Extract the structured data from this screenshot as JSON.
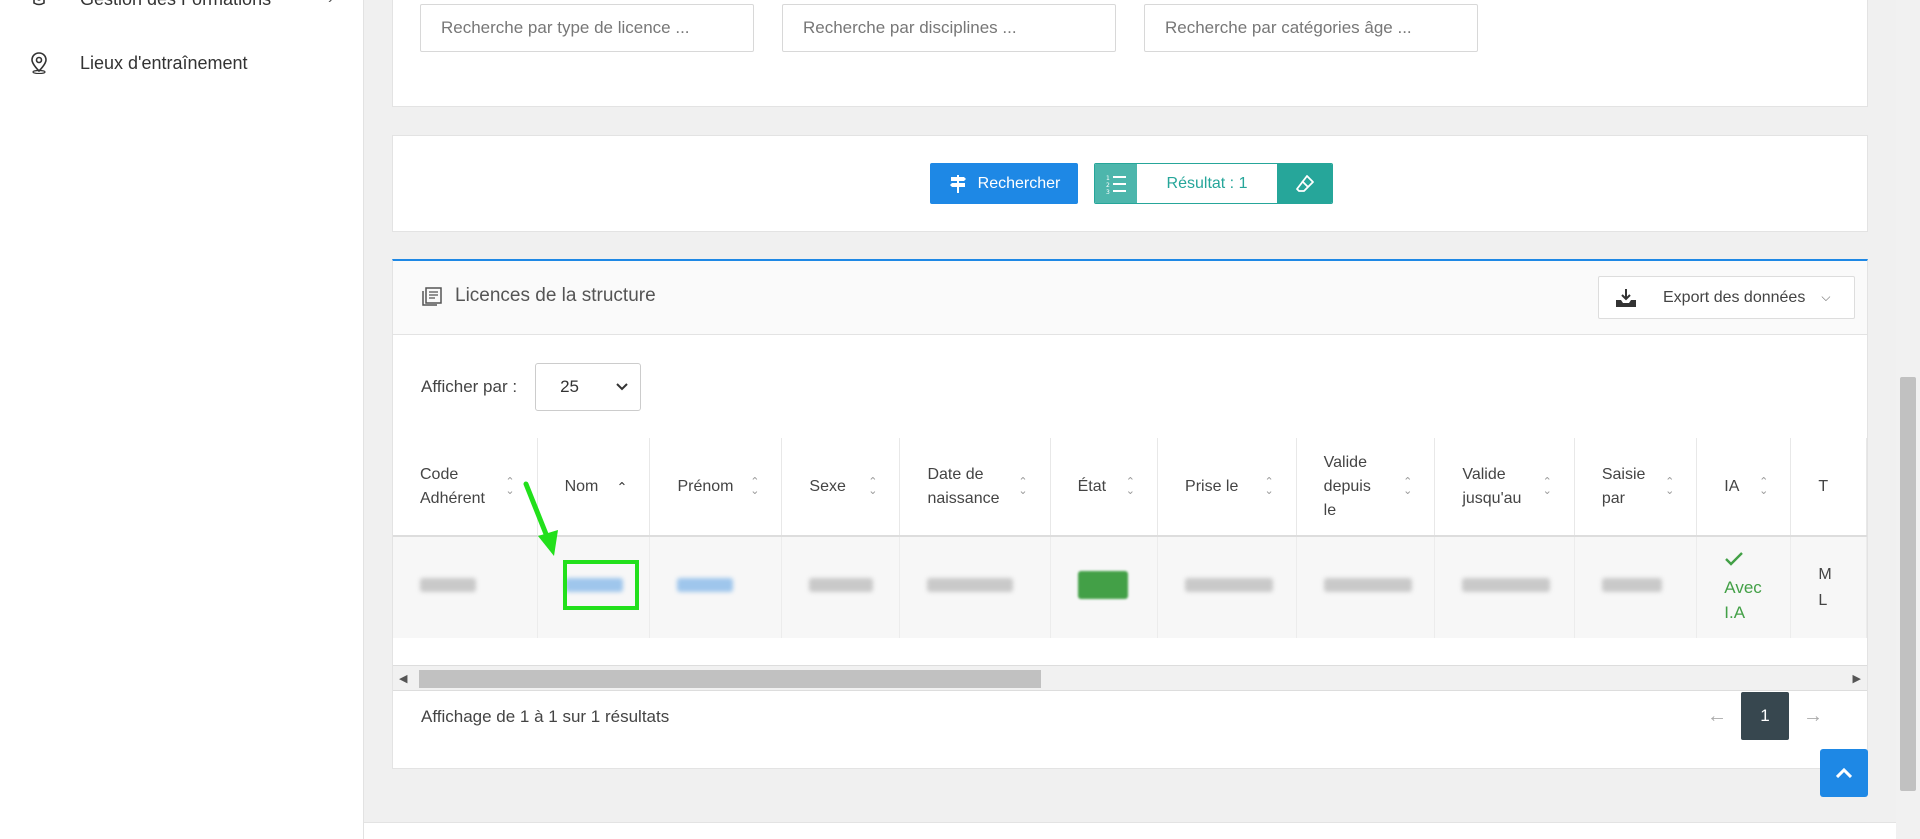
{
  "sidebar": {
    "items": [
      {
        "label": "Gestion des Formations",
        "icon": "graduation-cap-icon"
      },
      {
        "label": "Lieux d'entraînement",
        "icon": "map-pin-icon"
      }
    ]
  },
  "search": {
    "licence_placeholder": "Recherche par type de licence ...",
    "discipline_placeholder": "Recherche par disciplines ...",
    "category_placeholder": "Recherche par catégories âge ..."
  },
  "actions": {
    "search_label": "Rechercher",
    "result_label": "Résultat : 1"
  },
  "table_panel": {
    "title": "Licences de la structure",
    "export_label": "Export des données",
    "per_page_label": "Afficher par :",
    "per_page_value": "25",
    "footer": "Affichage de 1 à 1 sur 1 résultats",
    "current_page": "1"
  },
  "table": {
    "headers": [
      "Code Adhérent",
      "Nom",
      "Prénom",
      "Sexe",
      "Date de naissance",
      "État",
      "Prise le",
      "Valide depuis le",
      "Valide jusqu'au",
      "Saisie par",
      "IA",
      "T"
    ],
    "row": {
      "ia": "Avec I.A",
      "next": "M L"
    }
  },
  "colors": {
    "primary": "#1e88e5",
    "teal": "#26a69a",
    "success": "#43a047",
    "highlight": "#22e01b"
  }
}
